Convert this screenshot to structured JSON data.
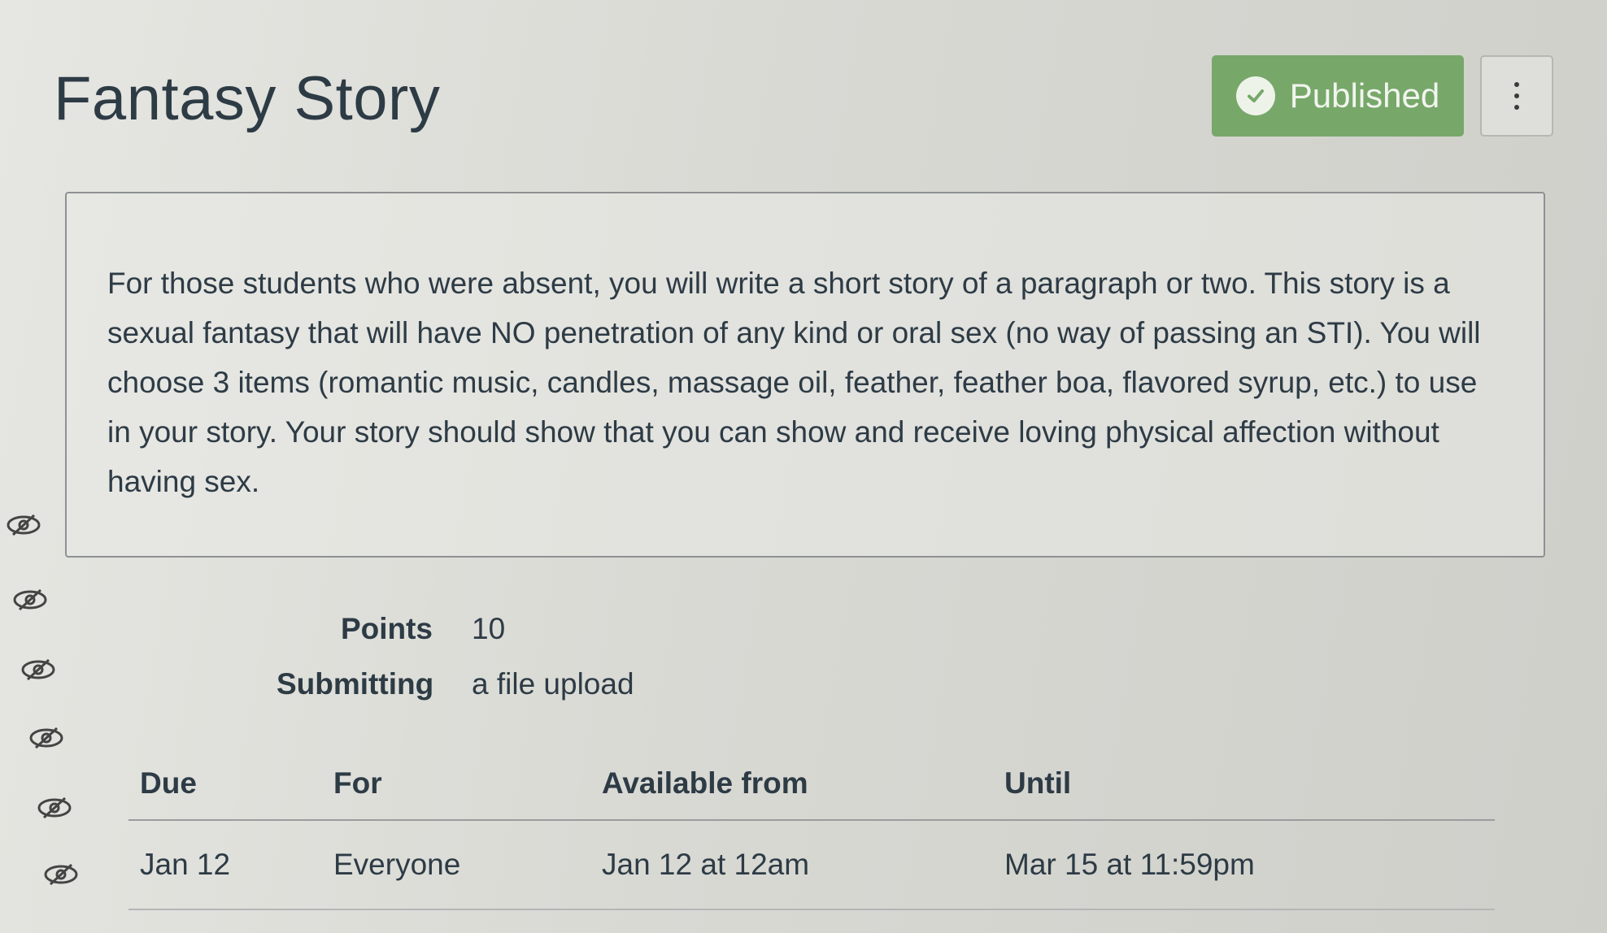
{
  "header": {
    "title": "Fantasy Story",
    "publish_label": "Published",
    "accent_color": "#77a86a"
  },
  "icons": {
    "publish": "check-circle-icon",
    "options": "kebab-menu-icon",
    "visibility": "eye-slash-icon"
  },
  "description": {
    "text": "For those students who were absent, you will write a short story of a paragraph or two. This story is a sexual fantasy that will have NO penetration of any kind or oral sex (no way of passing an STI). You will choose 3 items (romantic music, candles, massage oil, feather, feather boa, flavored syrup, etc.) to use in your story. Your story should show that you can show and receive loving physical affection without having sex."
  },
  "details": {
    "points_label": "Points",
    "points_value": "10",
    "submitting_label": "Submitting",
    "submitting_value": "a file upload"
  },
  "dates_table": {
    "headers": [
      "Due",
      "For",
      "Available from",
      "Until"
    ],
    "rows": [
      [
        "Jan 12",
        "Everyone",
        "Jan 12 at 12am",
        "Mar 15 at 11:59pm"
      ]
    ]
  }
}
